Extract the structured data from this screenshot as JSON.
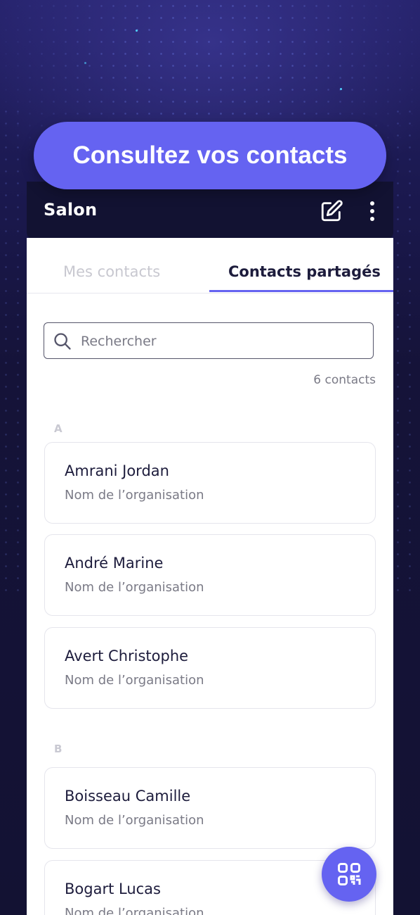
{
  "banner": {
    "text": "Consultez vos contacts"
  },
  "header": {
    "title": "Salon",
    "edit_icon": "edit-icon",
    "more_icon": "more-vertical-icon"
  },
  "tabs": [
    {
      "label": "Mes contacts",
      "active": false
    },
    {
      "label": "Contacts partagés",
      "active": true
    }
  ],
  "search": {
    "placeholder": "Rechercher",
    "value": ""
  },
  "contact_count": "6 contacts",
  "sections": [
    {
      "letter": "A",
      "contacts": [
        {
          "name": "Amrani Jordan",
          "organization": "Nom de l’organisation"
        },
        {
          "name": "André Marine",
          "organization": "Nom de l’organisation"
        },
        {
          "name": "Avert Christophe",
          "organization": "Nom de l’organisation"
        }
      ]
    },
    {
      "letter": "B",
      "contacts": [
        {
          "name": "Boisseau Camille",
          "organization": "Nom de l’organisation"
        },
        {
          "name": "Bogart Lucas",
          "organization": "Nom de l’organisation"
        }
      ]
    }
  ],
  "fab": {
    "icon": "qr-code-icon"
  },
  "colors": {
    "accent": "#6563f1",
    "header_bg": "#121232",
    "page_bg": "#161439",
    "text_dark": "#1d1c3c",
    "text_muted": "#7a7a86"
  }
}
